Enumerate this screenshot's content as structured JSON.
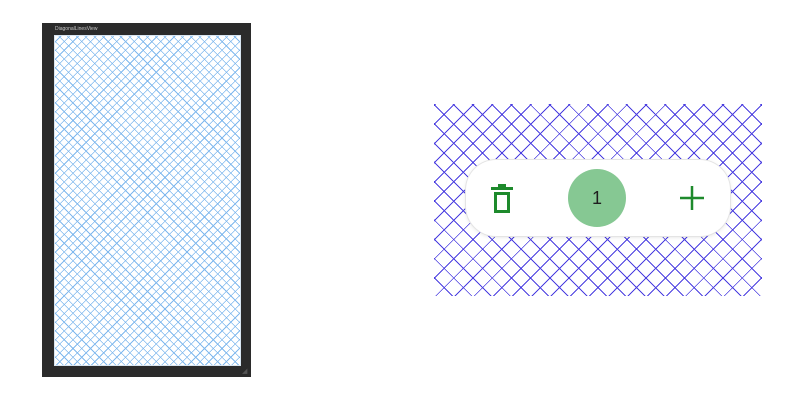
{
  "preview": {
    "title": "DiagonalLinesView",
    "line_color": "#7fb8ee",
    "frame_color": "#2b2b2b"
  },
  "component": {
    "pattern_line_color": "#4a3ee0",
    "count": "1",
    "badge_color": "#86c893",
    "icon_color": "#1e8a2c",
    "icons": {
      "delete": "trash-icon",
      "add": "plus-icon"
    }
  }
}
